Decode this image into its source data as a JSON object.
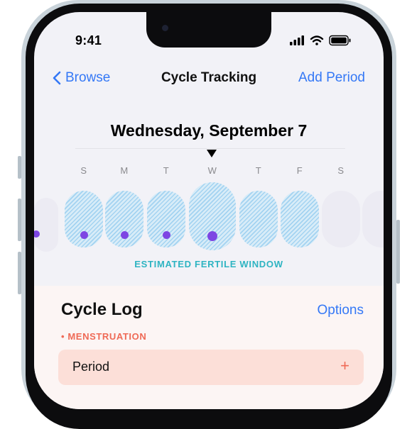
{
  "status_bar": {
    "time": "9:41"
  },
  "nav": {
    "back_label": "Browse",
    "title": "Cycle Tracking",
    "action_label": "Add Period"
  },
  "calendar": {
    "date_title": "Wednesday, September 7",
    "days": [
      {
        "letter": "S",
        "fertile": true,
        "has_dot": true,
        "selected": false
      },
      {
        "letter": "M",
        "fertile": true,
        "has_dot": true,
        "selected": false
      },
      {
        "letter": "T",
        "fertile": true,
        "has_dot": true,
        "selected": false
      },
      {
        "letter": "W",
        "fertile": true,
        "has_dot": true,
        "selected": true
      },
      {
        "letter": "T",
        "fertile": true,
        "has_dot": false,
        "selected": false
      },
      {
        "letter": "F",
        "fertile": true,
        "has_dot": false,
        "selected": false
      },
      {
        "letter": "S",
        "fertile": false,
        "has_dot": false,
        "selected": false
      }
    ],
    "fertile_label": "ESTIMATED FERTILE WINDOW",
    "colors": {
      "fertile": "#d8ecf8",
      "dot": "#7d46e3",
      "blank": "#ecebf3"
    }
  },
  "cycle_log": {
    "title": "Cycle Log",
    "action_label": "Options",
    "section_label": "MENSTRUATION",
    "rows": [
      {
        "label": "Period",
        "action": "+"
      }
    ],
    "colors": {
      "accent": "#ef6a56",
      "row_bg": "#fcdfd8"
    }
  }
}
